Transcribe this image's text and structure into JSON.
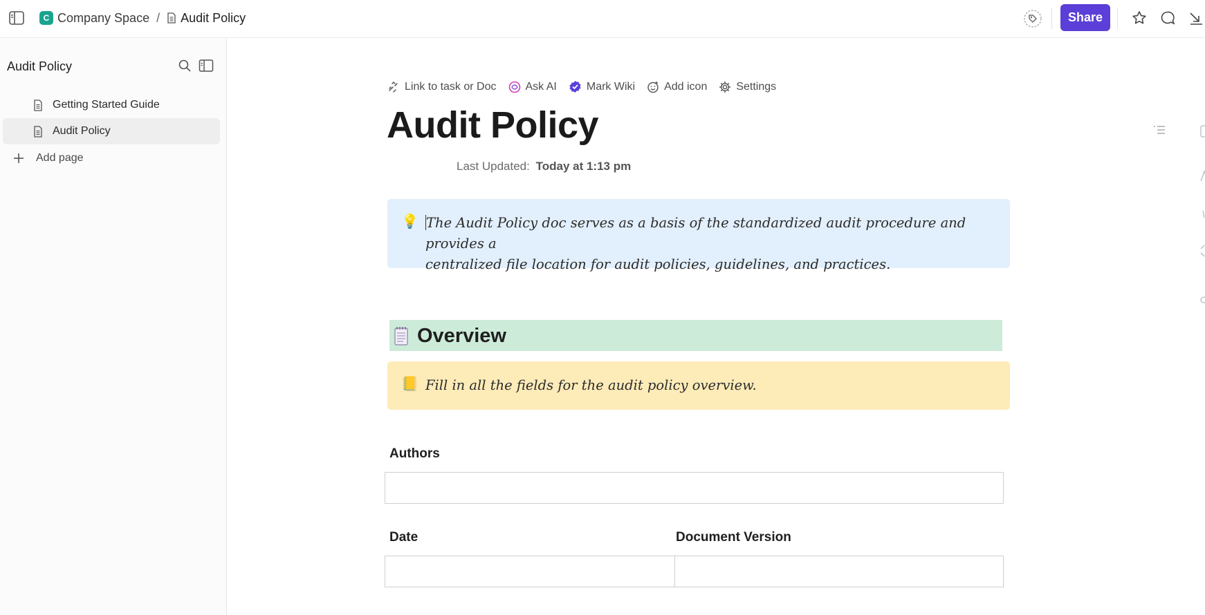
{
  "topbar": {
    "space_badge": "C",
    "space_name": "Company Space",
    "separator": "/",
    "current_doc": "Audit Policy",
    "share_label": "Share"
  },
  "sidebar": {
    "title": "Audit Policy",
    "items": [
      {
        "label": "Getting Started Guide",
        "active": false
      },
      {
        "label": "Audit Policy",
        "active": true
      }
    ],
    "add_page_label": "Add page"
  },
  "doc": {
    "toolbar": {
      "link_label": "Link to task or Doc",
      "ask_ai_label": "Ask AI",
      "mark_wiki_label": "Mark Wiki",
      "add_icon_label": "Add icon",
      "settings_label": "Settings"
    },
    "title": "Audit Policy",
    "last_updated_label": "Last Updated:",
    "last_updated_value": "Today at 1:13 pm",
    "intro_callout": {
      "emoji": "💡",
      "line1": "The Audit Policy doc serves as a basis of the standardized audit procedure and provides a",
      "line2": "centralized file location for audit policies, guidelines, and practices."
    },
    "overview_heading": "Overview",
    "overview_callout": {
      "emoji": "📒",
      "text": "Fill in all the fields for the audit policy overview."
    },
    "fields": {
      "authors_label": "Authors",
      "date_label": "Date",
      "version_label": "Document Version"
    }
  },
  "colors": {
    "accent": "#5b3fd8",
    "space_badge": "#1aa38f",
    "callout_blue": "#e2effc",
    "callout_yellow": "#fdebb8",
    "overview_green": "#cdebd9"
  }
}
